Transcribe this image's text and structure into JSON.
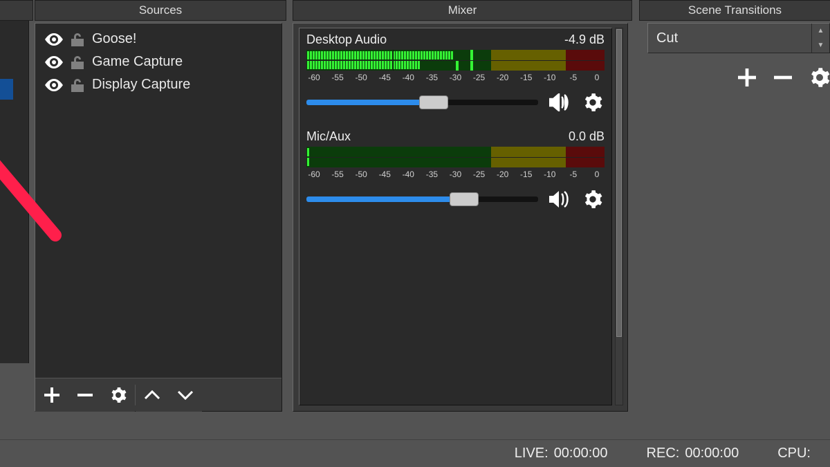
{
  "panels": {
    "sources": {
      "title": "Sources"
    },
    "mixer": {
      "title": "Mixer"
    },
    "transitions": {
      "title": "Scene Transitions"
    }
  },
  "sources": {
    "items": [
      {
        "name": "Goose!",
        "visible": true,
        "locked": false
      },
      {
        "name": "Game Capture",
        "visible": true,
        "locked": false
      },
      {
        "name": "Display Capture",
        "visible": true,
        "locked": false
      }
    ]
  },
  "mixer": {
    "scale_ticks": [
      "-60",
      "-55",
      "-50",
      "-45",
      "-40",
      "-35",
      "-30",
      "-25",
      "-20",
      "-15",
      "-10",
      "-5",
      "0"
    ],
    "channels": [
      {
        "name": "Desktop Audio",
        "level_db": "-4.9 dB",
        "meter": {
          "top_pct": 49,
          "bot_pct": 38,
          "hold_top_pct": 55,
          "hold_bot_pct": 50
        },
        "slider_pct": 55
      },
      {
        "name": "Mic/Aux",
        "level_db": "0.0 dB",
        "meter": {
          "top_pct": 1,
          "bot_pct": 1,
          "hold_top_pct": 0,
          "hold_bot_pct": 0
        },
        "slider_pct": 68
      }
    ]
  },
  "transitions": {
    "selected": "Cut"
  },
  "status": {
    "live_label": "LIVE:",
    "live_time": "00:00:00",
    "rec_label": "REC:",
    "rec_time": "00:00:00",
    "cpu_label": "CPU:"
  }
}
